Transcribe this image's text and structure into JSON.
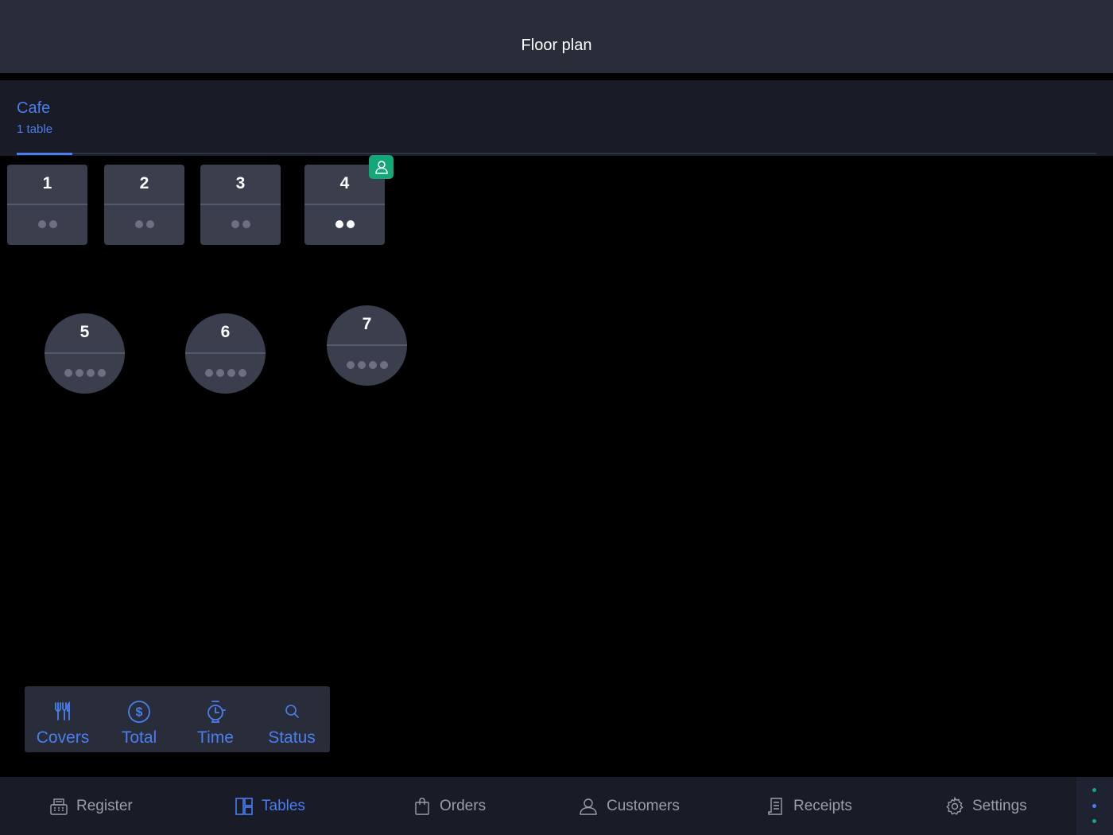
{
  "header": {
    "title": "Floor plan"
  },
  "area": {
    "name": "Cafe",
    "count": "1 table"
  },
  "tables": [
    {
      "number": "1",
      "shape": "rect",
      "seats": 2,
      "occupied": false
    },
    {
      "number": "2",
      "shape": "rect",
      "seats": 2,
      "occupied": false
    },
    {
      "number": "3",
      "shape": "rect",
      "seats": 2,
      "occupied": false
    },
    {
      "number": "4",
      "shape": "rect",
      "seats": 2,
      "occupied": true
    },
    {
      "number": "5",
      "shape": "round",
      "seats": 4,
      "occupied": false
    },
    {
      "number": "6",
      "shape": "round",
      "seats": 4,
      "occupied": false
    },
    {
      "number": "7",
      "shape": "round",
      "seats": 4,
      "occupied": false
    }
  ],
  "view_toolbar": {
    "covers": {
      "label": "Covers",
      "icon": "fork-knife-icon"
    },
    "total": {
      "label": "Total",
      "icon": "dollar-circle-icon"
    },
    "time": {
      "label": "Time",
      "icon": "stopwatch-icon"
    },
    "status": {
      "label": "Status",
      "icon": "search-icon"
    }
  },
  "tabbar": {
    "register": {
      "label": "Register",
      "icon": "cash-register-icon"
    },
    "tables": {
      "label": "Tables",
      "icon": "grid-icon"
    },
    "orders": {
      "label": "Orders",
      "icon": "bag-icon"
    },
    "customers": {
      "label": "Customers",
      "icon": "person-icon"
    },
    "receipts": {
      "label": "Receipts",
      "icon": "receipt-icon"
    },
    "settings": {
      "label": "Settings",
      "icon": "gear-icon"
    }
  },
  "colors": {
    "accent": "#4a7ef0",
    "occupied_badge": "#12a87a",
    "table_fill": "#3a3e4d",
    "inactive_text": "#9a9eab"
  }
}
